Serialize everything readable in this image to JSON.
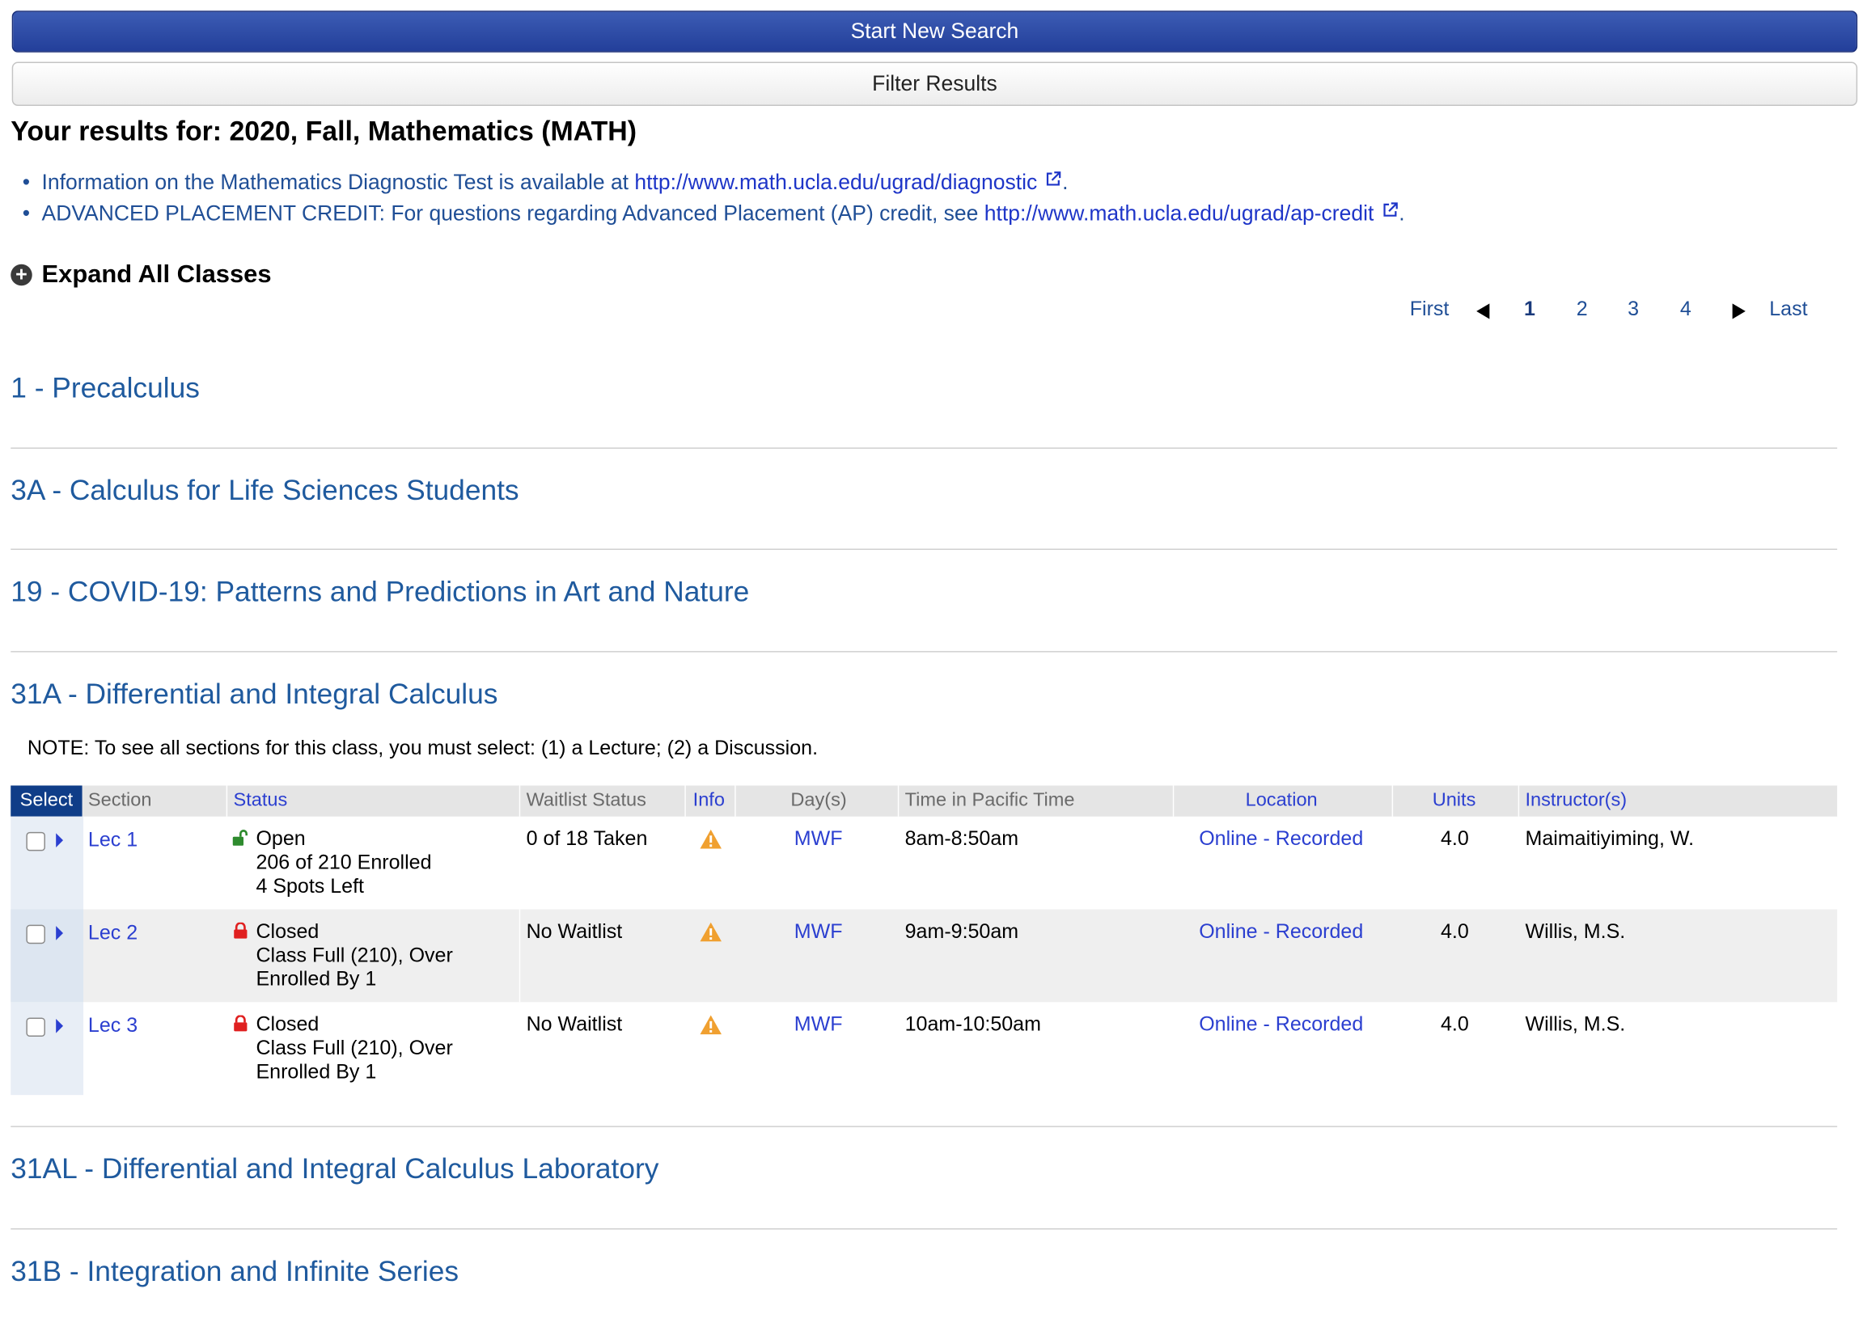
{
  "buttons": {
    "start_new_search": "Start New Search",
    "filter_results": "Filter Results"
  },
  "results_title": "Your results for: 2020, Fall, Mathematics (MATH)",
  "info": [
    {
      "text": "Information on the Mathematics Diagnostic Test is available at ",
      "link": "http://www.math.ucla.edu/ugrad/diagnostic",
      "suffix": "."
    },
    {
      "text": "ADVANCED PLACEMENT CREDIT: For questions regarding Advanced Placement (AP) credit, see ",
      "link": "http://www.math.ucla.edu/ugrad/ap-credit",
      "suffix": "."
    }
  ],
  "expand_all": "Expand All Classes",
  "pager": {
    "first": "First",
    "pages": [
      "1",
      "2",
      "3",
      "4"
    ],
    "current": "1",
    "last": "Last"
  },
  "courses": [
    "1 - Precalculus",
    "3A - Calculus for Life Sciences Students",
    "19 - COVID-19: Patterns and Predictions in Art and Nature",
    "31A - Differential and Integral Calculus",
    "31AL - Differential and Integral Calculus Laboratory",
    "31B - Integration and Infinite Series"
  ],
  "note": "NOTE: To see all sections for this class, you must select: (1) a Lecture; (2) a Discussion.",
  "table": {
    "headers": {
      "select": "Select",
      "section": "Section",
      "status": "Status",
      "waitlist": "Waitlist Status",
      "info": "Info",
      "days": "Day(s)",
      "time": "Time in Pacific Time",
      "location": "Location",
      "units": "Units",
      "instructors": "Instructor(s)"
    },
    "rows": [
      {
        "section": "Lec 1",
        "status": "Open",
        "status_line2": "206 of 210 Enrolled",
        "status_line3": "4 Spots Left",
        "lock": "unlocked-icon",
        "waitlist": "0 of 18 Taken",
        "days": "MWF",
        "time": "8am-8:50am",
        "location": "Online - Recorded",
        "units": "4.0",
        "instructor": "Maimaitiyiming, W."
      },
      {
        "section": "Lec 2",
        "status": "Closed",
        "status_line2": "Class Full (210), Over",
        "status_line3": "Enrolled By 1",
        "lock": "locked-icon",
        "waitlist": "No Waitlist",
        "days": "MWF",
        "time": "9am-9:50am",
        "location": "Online - Recorded",
        "units": "4.0",
        "instructor": "Willis, M.S."
      },
      {
        "section": "Lec 3",
        "status": "Closed",
        "status_line2": "Class Full (210), Over",
        "status_line3": "Enrolled By 1",
        "lock": "locked-icon",
        "waitlist": "No Waitlist",
        "days": "MWF",
        "time": "10am-10:50am",
        "location": "Online - Recorded",
        "units": "4.0",
        "instructor": "Willis, M.S."
      }
    ]
  },
  "colors": {
    "primary_button": "#233f9a",
    "link": "#1f5a9e",
    "open": "#2e8b2e",
    "closed": "#e02020",
    "warning": "#f0a030"
  }
}
